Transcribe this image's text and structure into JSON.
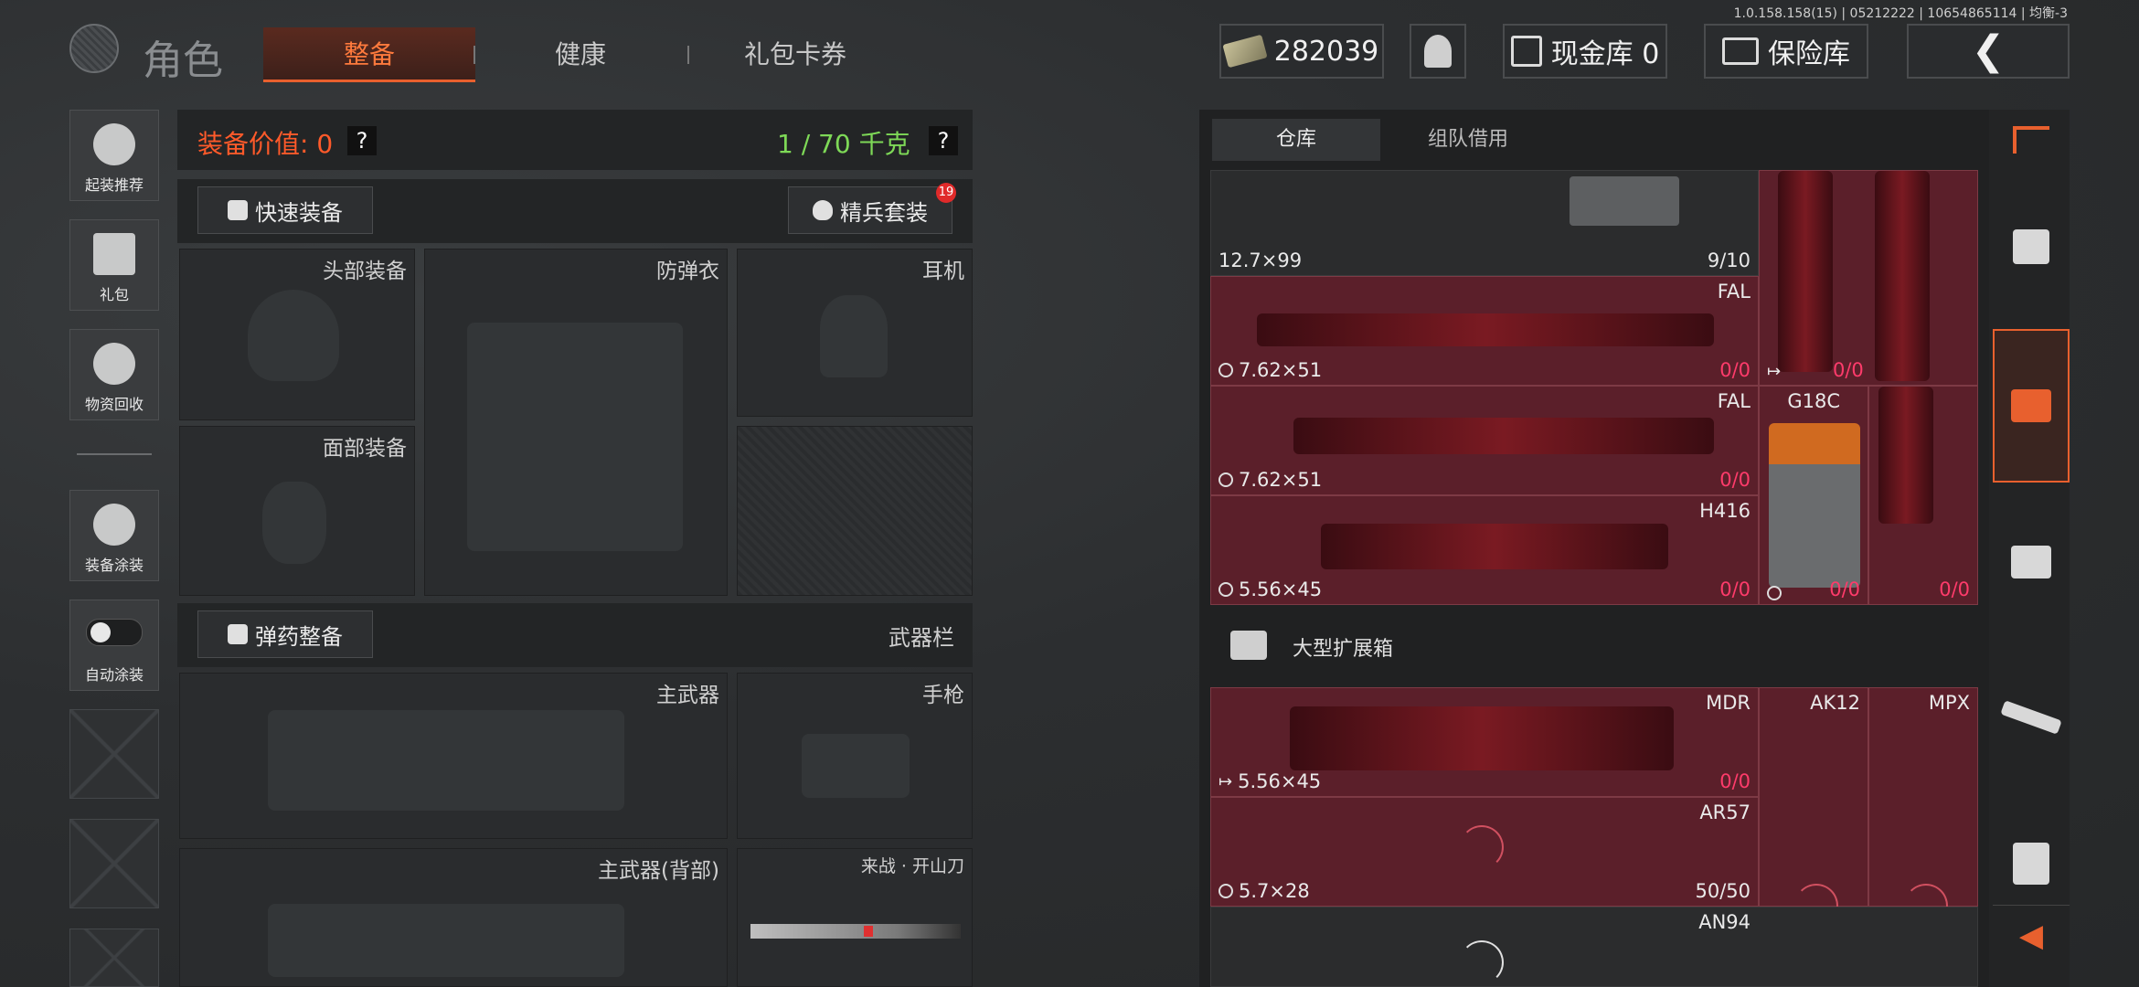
{
  "version": "1.0.158.158(15) | 05212222 | 10654865114 | 均衡-3",
  "header": {
    "title": "角色",
    "tabs": [
      {
        "label": "整备",
        "active": true
      },
      {
        "label": "健康",
        "active": false
      },
      {
        "label": "礼包卡券",
        "active": false
      }
    ],
    "money": "282039",
    "cash_vault_label": "现金库 0",
    "safe_label": "保险库",
    "back_icon": "chevron-left-icon"
  },
  "sidebar": {
    "items": [
      {
        "label": "起装推荐",
        "icon": "helmet-gun-icon"
      },
      {
        "label": "礼包",
        "icon": "gift-icon"
      },
      {
        "label": "物资回收",
        "icon": "recycle-icon"
      },
      {
        "label": "装备涂装",
        "icon": "skin-icon"
      },
      {
        "label": "自动涂装",
        "icon": "toggle-icon"
      }
    ]
  },
  "equipment": {
    "value_label": "装备价值: 0",
    "weight": "1 / 70 千克",
    "quick_equip": "快速装备",
    "elite_set": "精兵套装",
    "elite_badge": "19",
    "slots": {
      "head": "头部装备",
      "armor": "防弹衣",
      "headset": "耳机",
      "face": "面部装备",
      "ammo_btn": "弹药整备",
      "weapon_bar": "武器栏",
      "primary": "主武器",
      "pistol": "手枪",
      "primary_back": "主武器(背部)",
      "melee": "来战 · 开山刀"
    },
    "help": "?"
  },
  "warehouse": {
    "tabs": [
      {
        "label": "仓库",
        "active": true
      },
      {
        "label": "组队借用",
        "active": false
      }
    ],
    "section_large": "大型扩展箱",
    "items": [
      {
        "name": "",
        "ammo": "12.7×99",
        "count": "9/10"
      },
      {
        "name": "FAL",
        "ammo": "7.62×51",
        "count": "0/0"
      },
      {
        "name": "FAL",
        "ammo": "7.62×51",
        "count": "0/0"
      },
      {
        "name": "H416",
        "ammo": "5.56×45",
        "count": "0/0"
      },
      {
        "name": "G18C",
        "ammo": "",
        "count": "0/0"
      },
      {
        "name": "MDR",
        "ammo": "5.56×45",
        "count": "0/0"
      },
      {
        "name": "AK12",
        "ammo": "",
        "count": ""
      },
      {
        "name": "MPX",
        "ammo": "",
        "count": ""
      },
      {
        "name": "AR57",
        "ammo": "5.7×28",
        "count": "50/50"
      },
      {
        "name": "AN94",
        "ammo": "",
        "count": ""
      }
    ],
    "side_counts": [
      "0/0",
      "0/0",
      "0/0"
    ]
  },
  "right_nav": [
    "sort-icon",
    "home-icon",
    "case-icon",
    "box-icon",
    "rifle-icon",
    "vest-icon",
    "collapse-icon"
  ],
  "colors": {
    "accent": "#e8602e",
    "warn": "#ff3b6b",
    "weight_ok": "#7ed957",
    "cell": "#5b1f2a"
  }
}
